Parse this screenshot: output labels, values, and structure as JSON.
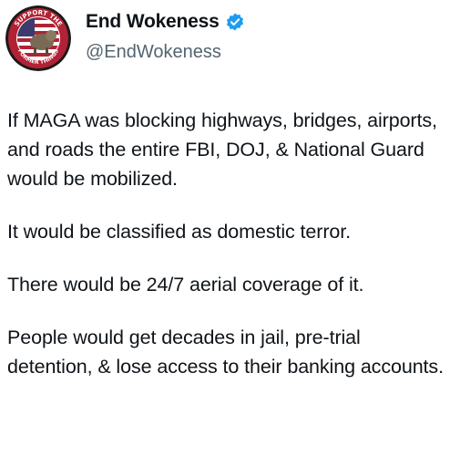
{
  "author": {
    "display_name": "End Wokeness",
    "handle": "@EndWokeness",
    "verified": true,
    "avatar_text_top": "SUPPORT THE",
    "avatar_text_bottom": "FORMER THINGS",
    "verified_color": "#1d9bf0"
  },
  "tweet": {
    "paragraphs": [
      "If MAGA was blocking highways, bridges, airports, and roads the entire FBI, DOJ, & National Guard would be mobilized.",
      "It would be classified as domestic terror.",
      "There would be 24/7 aerial coverage of it.",
      "People would get decades in jail, pre-trial detention, & lose access to their banking accounts."
    ]
  }
}
